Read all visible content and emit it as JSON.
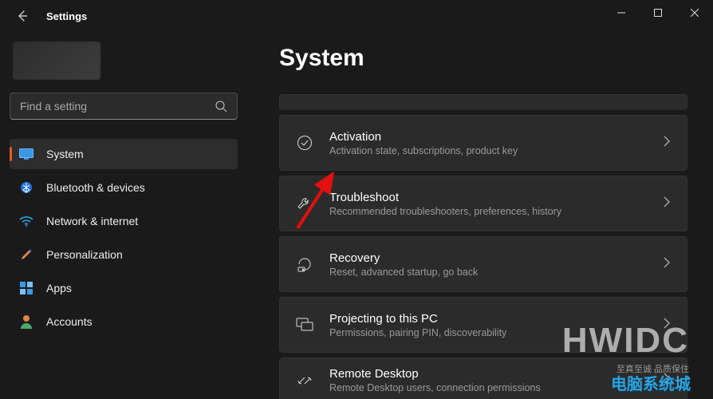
{
  "app_title": "Settings",
  "search": {
    "placeholder": "Find a setting"
  },
  "nav": [
    {
      "label": "System",
      "icon": "display"
    },
    {
      "label": "Bluetooth & devices",
      "icon": "bluetooth"
    },
    {
      "label": "Network & internet",
      "icon": "wifi"
    },
    {
      "label": "Personalization",
      "icon": "brush"
    },
    {
      "label": "Apps",
      "icon": "apps"
    },
    {
      "label": "Accounts",
      "icon": "person"
    }
  ],
  "page": {
    "title": "System"
  },
  "rows": [
    {
      "title": "Activation",
      "sub": "Activation state, subscriptions, product key"
    },
    {
      "title": "Troubleshoot",
      "sub": "Recommended troubleshooters, preferences, history"
    },
    {
      "title": "Recovery",
      "sub": "Reset, advanced startup, go back"
    },
    {
      "title": "Projecting to this PC",
      "sub": "Permissions, pairing PIN, discoverability"
    },
    {
      "title": "Remote Desktop",
      "sub": "Remote Desktop users, connection permissions"
    }
  ],
  "watermark": {
    "main": "HWIDC",
    "sub": "至真至诚 品质保住",
    "cn": "电脑系统城"
  }
}
